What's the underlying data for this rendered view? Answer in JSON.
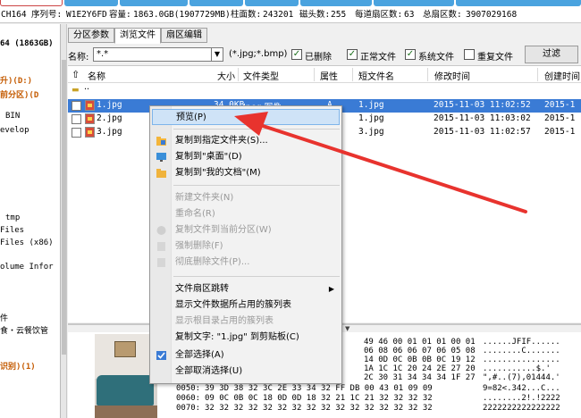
{
  "disk": {
    "model": "CH164",
    "serial_label": "序列号:",
    "serial": "W1E2Y6FD",
    "capacity_label": "容量:",
    "capacity": "1863.0GB(1907729MB)",
    "cylinders_label": "柱面数:",
    "cylinders": "243201",
    "heads_label": "磁头数:",
    "heads": "255",
    "sectors_per_track_label": "每道扇区数:",
    "sectors_per_track": "63",
    "total_sectors_label": "总扇区数:",
    "total_sectors": "3907029168"
  },
  "tree": {
    "items": [
      "64 (1863GB)",
      "升)(D:)",
      "前分区)(D",
      "BIN",
      "evelop",
      "tmp",
      "Files",
      "Files (x86)",
      "olume Infor",
      "件",
      "食・云餐饮管",
      "识别)(1)"
    ]
  },
  "tabs": [
    "分区参数",
    "浏览文件",
    "扇区编辑"
  ],
  "filter": {
    "name_label": "名称:",
    "name_value": "*.*",
    "pattern_hint": "(*.jpg;*.bmp)",
    "checks": [
      {
        "label": "已删除",
        "checked": true
      },
      {
        "label": "正常文件",
        "checked": true
      },
      {
        "label": "系统文件",
        "checked": true
      },
      {
        "label": "重复文件",
        "checked": false
      }
    ],
    "button": "过滤"
  },
  "columns": [
    "名称",
    "大小",
    "文件类型",
    "属性",
    "短文件名",
    "修改时间",
    "创建时间"
  ],
  "files": [
    {
      "name": "..",
      "size": "",
      "type": "",
      "attr": "",
      "short": "",
      "modified": "",
      "created": ""
    },
    {
      "name": "1.jpg",
      "size": "34.0KB",
      "type": "Jpeg 图像",
      "attr": "A",
      "short": "1.jpg",
      "modified": "2015-11-03 11:02:52",
      "created": "2015-1"
    },
    {
      "name": "2.jpg",
      "size": "",
      "type": "",
      "attr": "",
      "short": "1.jpg",
      "modified": "2015-11-03 11:03:02",
      "created": "2015-1"
    },
    {
      "name": "3.jpg",
      "size": "",
      "type": "",
      "attr": "",
      "short": "3.jpg",
      "modified": "2015-11-03 11:02:57",
      "created": "2015-1"
    }
  ],
  "hex": {
    "rows": [
      {
        "offset": "",
        "bytes": "49 46 00 01 01 01 00 01",
        "ascii": "......JFIF......"
      },
      {
        "offset": "",
        "bytes": "06 08 06 06 07 06 05 08",
        "ascii": "........C......."
      },
      {
        "offset": "",
        "bytes": "14 0D 0C 0B 0B 0C 19 12",
        "ascii": "................"
      },
      {
        "offset": "",
        "bytes": "1A 1C 1C 20 24 2E 27 20",
        "ascii": "...........$.' "
      },
      {
        "offset": "",
        "bytes": "2C 30 31 34 34 34 1F 27",
        "ascii": "\",#..(7),01444.'"
      },
      {
        "offset": "0050:",
        "bytes": "39 3D 38 32 3C 2E 33 34 32 FF DB 00 43 01 09 09",
        "ascii": "9=82<.342...C..."
      },
      {
        "offset": "0060:",
        "bytes": "09 0C 0B 0C 18 0D 0D 18 32 21 1C 21 32 32 32 32",
        "ascii": "........2!.!2222"
      },
      {
        "offset": "0070:",
        "bytes": "32 32 32 32 32 32 32 32 32 32 32 32 32 32 32 32",
        "ascii": "2222222222222222"
      }
    ]
  },
  "context_menu": {
    "items": [
      {
        "label": "预览(P)",
        "disabled": false,
        "highlight": true,
        "icon": ""
      },
      {
        "label": "复制到指定文件夹(S)...",
        "disabled": false,
        "icon": "copy-to-folder-icon"
      },
      {
        "label": "复制到\"桌面\"(D)",
        "disabled": false,
        "icon": "desktop-icon"
      },
      {
        "label": "复制到\"我的文档\"(M)",
        "disabled": false,
        "icon": "folder-icon"
      },
      {
        "label": "新建文件夹(N)",
        "disabled": true,
        "icon": ""
      },
      {
        "label": "重命名(R)",
        "disabled": true,
        "icon": ""
      },
      {
        "label": "复制文件到当前分区(W)",
        "disabled": true,
        "icon": "copy-partition-icon"
      },
      {
        "label": "强制删除(F)",
        "disabled": true,
        "icon": "force-delete-icon"
      },
      {
        "label": "彻底删除文件(P)...",
        "disabled": true,
        "icon": "wipe-file-icon"
      },
      {
        "label": "文件扇区跳转",
        "disabled": false,
        "icon": "",
        "submenu": true
      },
      {
        "label": "显示文件数据所占用的簇列表",
        "disabled": false,
        "icon": ""
      },
      {
        "label": "显示根目录占用的簇列表",
        "disabled": true,
        "icon": ""
      },
      {
        "label": "复制文字: \"1.jpg\" 到剪贴板(C)",
        "disabled": false,
        "icon": ""
      },
      {
        "label": "全部选择(A)",
        "disabled": false,
        "icon": "checkbox-icon"
      },
      {
        "label": "全部取消选择(U)",
        "disabled": false,
        "icon": ""
      }
    ]
  },
  "colors": {
    "selection": "#3a7bd5",
    "arrow": "#e8332e",
    "highlight": "#cfe3f7"
  }
}
